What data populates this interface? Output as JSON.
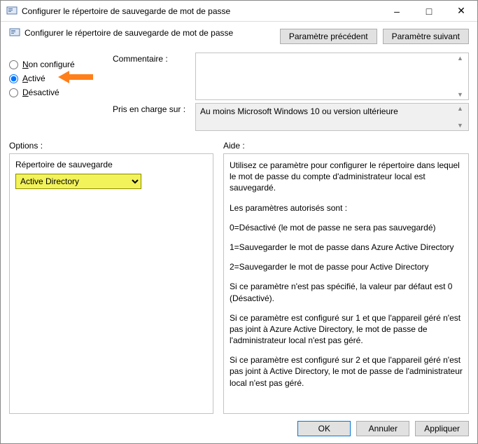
{
  "window": {
    "title": "Configurer le répertoire de sauvegarde de mot de passe",
    "subtitle": "Configurer le répertoire de sauvegarde de mot de passe"
  },
  "nav": {
    "prev_label": "Paramètre précédent",
    "next_label": "Paramètre suivant"
  },
  "state": {
    "not_configured_label_pre": "N",
    "not_configured_label_rest": "on configuré",
    "enabled_label_pre": "A",
    "enabled_label_rest": "ctivé",
    "disabled_label_pre": "D",
    "disabled_label_rest": "ésactivé",
    "selected": "enabled"
  },
  "labels": {
    "comment": "Commentaire :",
    "supported_on": "Pris en charge sur :",
    "options": "Options :",
    "help": "Aide :"
  },
  "supported_on_text": "Au moins Microsoft Windows 10 ou version ultérieure",
  "options_panel": {
    "dropdown_label": "Répertoire de sauvegarde",
    "dropdown_value": "Active Directory"
  },
  "help_text": {
    "p1": "Utilisez ce paramètre pour configurer le répertoire dans lequel le mot de passe du compte d'administrateur local est sauvegardé.",
    "p2": "Les paramètres autorisés sont :",
    "p3": "0=Désactivé (le mot de passe ne sera pas sauvegardé)",
    "p4": "1=Sauvegarder le mot de passe dans Azure Active Directory",
    "p5": "2=Sauvegarder le mot de passe pour Active Directory",
    "p6": "Si ce paramètre n'est pas spécifié, la valeur par défaut est 0 (Désactivé).",
    "p7": "Si ce paramètre est configuré sur 1 et que l'appareil géré n'est pas joint à Azure Active Directory, le mot de passe de l'administrateur local n'est pas géré.",
    "p8": "Si ce paramètre est configuré sur 2 et que l'appareil géré n'est pas joint à Active Directory, le mot de passe de l'administrateur local n'est pas géré."
  },
  "footer": {
    "ok": "OK",
    "cancel": "Annuler",
    "apply": "Appliquer"
  }
}
